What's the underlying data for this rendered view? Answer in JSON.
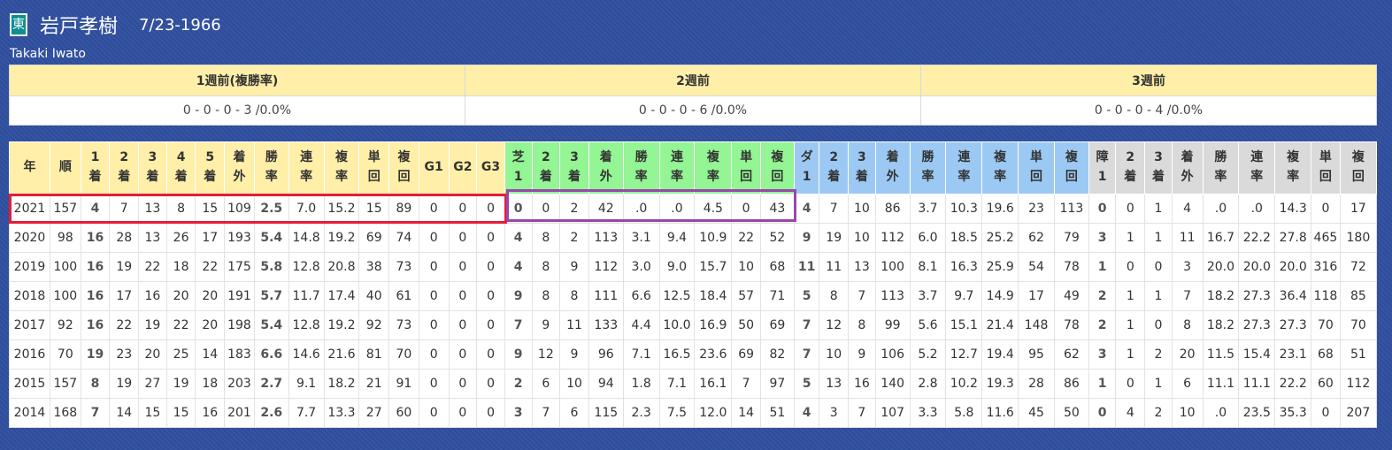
{
  "jockey": {
    "badge": "東",
    "name": "岩戸孝樹",
    "birthdate": "7/23-1966",
    "romaji": "Takaki Iwato"
  },
  "weeks": {
    "headers": [
      "1週前(複勝率)",
      "2週前",
      "3週前"
    ],
    "values": [
      "0 - 0 - 0 - 3 /0.0%",
      "0 - 0 - 0 - 6 /0.0%",
      "0 - 0 - 0 - 4 /0.0%"
    ]
  },
  "stats": {
    "headers": [
      [
        "年"
      ],
      [
        "順"
      ],
      [
        "1",
        "着"
      ],
      [
        "2",
        "着"
      ],
      [
        "3",
        "着"
      ],
      [
        "4",
        "着"
      ],
      [
        "5",
        "着"
      ],
      [
        "着",
        "外"
      ],
      [
        "勝",
        "率"
      ],
      [
        "連",
        "率"
      ],
      [
        "複",
        "率"
      ],
      [
        "単",
        "回"
      ],
      [
        "複",
        "回"
      ],
      [
        "G1"
      ],
      [
        "G2"
      ],
      [
        "G3"
      ],
      [
        "芝",
        "1"
      ],
      [
        "2",
        "着"
      ],
      [
        "3",
        "着"
      ],
      [
        "着",
        "外"
      ],
      [
        "勝",
        "率"
      ],
      [
        "連",
        "率"
      ],
      [
        "複",
        "率"
      ],
      [
        "単",
        "回"
      ],
      [
        "複",
        "回"
      ],
      [
        "ダ",
        "1"
      ],
      [
        "2",
        "着"
      ],
      [
        "3",
        "着"
      ],
      [
        "着",
        "外"
      ],
      [
        "勝",
        "率"
      ],
      [
        "連",
        "率"
      ],
      [
        "複",
        "率"
      ],
      [
        "単",
        "回"
      ],
      [
        "複",
        "回"
      ],
      [
        "障",
        "1"
      ],
      [
        "2",
        "着"
      ],
      [
        "3",
        "着"
      ],
      [
        "着",
        "外"
      ],
      [
        "勝",
        "率"
      ],
      [
        "連",
        "率"
      ],
      [
        "複",
        "率"
      ],
      [
        "単",
        "回"
      ],
      [
        "複",
        "回"
      ]
    ],
    "rows": [
      [
        "2021",
        "157",
        "4",
        "7",
        "13",
        "8",
        "15",
        "109",
        "2.5",
        "7.0",
        "15.2",
        "15",
        "89",
        "0",
        "0",
        "0",
        "0",
        "0",
        "2",
        "42",
        ".0",
        ".0",
        "4.5",
        "0",
        "43",
        "4",
        "7",
        "10",
        "86",
        "3.7",
        "10.3",
        "19.6",
        "23",
        "113",
        "0",
        "0",
        "1",
        "4",
        ".0",
        ".0",
        "14.3",
        "0",
        "17"
      ],
      [
        "2020",
        "98",
        "16",
        "28",
        "13",
        "26",
        "17",
        "193",
        "5.4",
        "14.8",
        "19.2",
        "69",
        "74",
        "0",
        "0",
        "0",
        "4",
        "8",
        "2",
        "113",
        "3.1",
        "9.4",
        "10.9",
        "22",
        "52",
        "9",
        "19",
        "10",
        "112",
        "6.0",
        "18.5",
        "25.2",
        "62",
        "79",
        "3",
        "1",
        "1",
        "11",
        "16.7",
        "22.2",
        "27.8",
        "465",
        "180"
      ],
      [
        "2019",
        "100",
        "16",
        "19",
        "22",
        "18",
        "22",
        "175",
        "5.8",
        "12.8",
        "20.8",
        "38",
        "73",
        "0",
        "0",
        "0",
        "4",
        "8",
        "9",
        "112",
        "3.0",
        "9.0",
        "15.7",
        "10",
        "68",
        "11",
        "11",
        "13",
        "100",
        "8.1",
        "16.3",
        "25.9",
        "54",
        "78",
        "1",
        "0",
        "0",
        "3",
        "20.0",
        "20.0",
        "20.0",
        "316",
        "72"
      ],
      [
        "2018",
        "100",
        "16",
        "17",
        "16",
        "20",
        "20",
        "191",
        "5.7",
        "11.7",
        "17.4",
        "40",
        "61",
        "0",
        "0",
        "0",
        "9",
        "8",
        "8",
        "111",
        "6.6",
        "12.5",
        "18.4",
        "57",
        "71",
        "5",
        "8",
        "7",
        "113",
        "3.7",
        "9.7",
        "14.9",
        "17",
        "49",
        "2",
        "1",
        "1",
        "7",
        "18.2",
        "27.3",
        "36.4",
        "118",
        "85"
      ],
      [
        "2017",
        "92",
        "16",
        "22",
        "19",
        "22",
        "20",
        "198",
        "5.4",
        "12.8",
        "19.2",
        "92",
        "73",
        "0",
        "0",
        "0",
        "7",
        "9",
        "11",
        "133",
        "4.4",
        "10.0",
        "16.9",
        "50",
        "69",
        "7",
        "12",
        "8",
        "99",
        "5.6",
        "15.1",
        "21.4",
        "148",
        "78",
        "2",
        "1",
        "0",
        "8",
        "18.2",
        "27.3",
        "27.3",
        "70",
        "70"
      ],
      [
        "2016",
        "70",
        "19",
        "23",
        "20",
        "25",
        "14",
        "183",
        "6.6",
        "14.6",
        "21.6",
        "81",
        "70",
        "0",
        "0",
        "0",
        "9",
        "12",
        "9",
        "96",
        "7.1",
        "16.5",
        "23.6",
        "69",
        "82",
        "7",
        "10",
        "9",
        "106",
        "5.2",
        "12.7",
        "19.4",
        "95",
        "62",
        "3",
        "1",
        "2",
        "20",
        "11.5",
        "15.4",
        "23.1",
        "68",
        "51"
      ],
      [
        "2015",
        "157",
        "8",
        "19",
        "27",
        "19",
        "18",
        "203",
        "2.7",
        "9.1",
        "18.2",
        "21",
        "91",
        "0",
        "0",
        "0",
        "2",
        "6",
        "10",
        "94",
        "1.8",
        "7.1",
        "16.1",
        "7",
        "97",
        "5",
        "13",
        "16",
        "140",
        "2.8",
        "10.2",
        "19.3",
        "28",
        "86",
        "1",
        "0",
        "1",
        "6",
        "11.1",
        "11.1",
        "22.2",
        "60",
        "112"
      ],
      [
        "2014",
        "168",
        "7",
        "14",
        "15",
        "15",
        "16",
        "201",
        "2.6",
        "7.7",
        "13.3",
        "27",
        "60",
        "0",
        "0",
        "0",
        "3",
        "7",
        "6",
        "115",
        "2.3",
        "7.5",
        "12.0",
        "14",
        "51",
        "4",
        "3",
        "7",
        "107",
        "3.3",
        "5.8",
        "11.6",
        "45",
        "50",
        "0",
        "4",
        "2",
        "10",
        ".0",
        "23.5",
        "35.3",
        "0",
        "207"
      ]
    ]
  }
}
